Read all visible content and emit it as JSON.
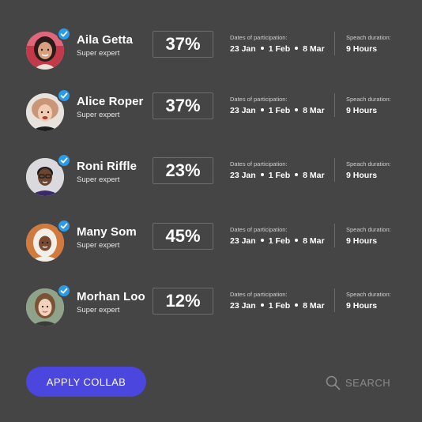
{
  "participants": [
    {
      "name": "Aila Getta",
      "role": "Super expert",
      "percent": "37%",
      "dates_label": "Dates of participation:",
      "dates": [
        "23 Jan",
        "1 Feb",
        "8 Mar"
      ],
      "speech_label": "Speach duration:",
      "speech": "9 Hours",
      "verified": true
    },
    {
      "name": "Alice Roper",
      "role": "Super expert",
      "percent": "37%",
      "dates_label": "Dates of participation:",
      "dates": [
        "23 Jan",
        "1 Feb",
        "8 Mar"
      ],
      "speech_label": "Speach duration:",
      "speech": "9 Hours",
      "verified": true
    },
    {
      "name": "Roni Riffle",
      "role": "Super expert",
      "percent": "23%",
      "dates_label": "Dates of participation:",
      "dates": [
        "23 Jan",
        "1 Feb",
        "8 Mar"
      ],
      "speech_label": "Speach duration:",
      "speech": "9 Hours",
      "verified": true
    },
    {
      "name": "Many Som",
      "role": "Super expert",
      "percent": "45%",
      "dates_label": "Dates of participation:",
      "dates": [
        "23 Jan",
        "1 Feb",
        "8 Mar"
      ],
      "speech_label": "Speach duration:",
      "speech": "9 Hours",
      "verified": true
    },
    {
      "name": "Morhan Loo",
      "role": "Super expert",
      "percent": "12%",
      "dates_label": "Dates of participation:",
      "dates": [
        "23 Jan",
        "1 Feb",
        "8 Mar"
      ],
      "speech_label": "Speach duration:",
      "speech": "9 Hours",
      "verified": true
    }
  ],
  "actions": {
    "apply_label": "APPLY COLLAB",
    "search_label": "SEARCH",
    "search_icon": "search-icon"
  },
  "colors": {
    "background": "#454545",
    "accent": "#4a46de",
    "verified": "#2b9be8"
  }
}
